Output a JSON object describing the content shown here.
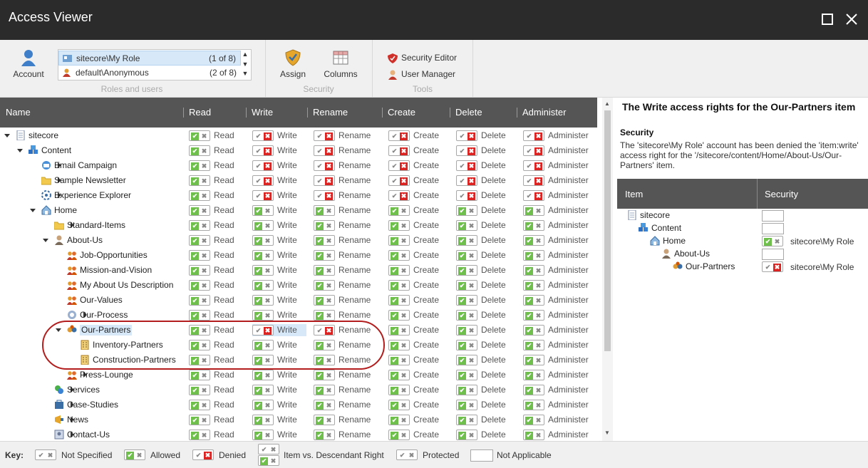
{
  "window": {
    "title": "Access Viewer",
    "maximize_icon": "maximize-icon",
    "close_icon": "close-icon"
  },
  "ribbon": {
    "account_label": "Account",
    "roles": [
      {
        "name": "sitecore\\My Role",
        "count": "(1 of 8)",
        "selected": true
      },
      {
        "name": "default\\Anonymous",
        "count": "(2 of 8)",
        "selected": false
      }
    ],
    "roles_group": "Roles and users",
    "assign_label": "Assign",
    "columns_label": "Columns",
    "security_group": "Security",
    "security_editor": "Security Editor",
    "user_manager": "User Manager",
    "tools_group": "Tools"
  },
  "grid": {
    "columns": [
      "Name",
      "Read",
      "Write",
      "Rename",
      "Create",
      "Delete",
      "Administer"
    ],
    "rows": [
      {
        "name": "sitecore",
        "level": 0,
        "toggle": "expanded",
        "icon": "page",
        "states": [
          "allowed",
          "denied",
          "denied",
          "denied",
          "denied",
          "denied"
        ]
      },
      {
        "name": "Content",
        "level": 1,
        "toggle": "expanded",
        "icon": "content",
        "states": [
          "allowed",
          "denied",
          "denied",
          "denied",
          "denied",
          "denied"
        ]
      },
      {
        "name": "Email Campaign",
        "level": 2,
        "toggle": "collapsed",
        "icon": "email",
        "states": [
          "allowed",
          "denied",
          "denied",
          "denied",
          "denied",
          "denied"
        ]
      },
      {
        "name": "Sample Newsletter",
        "level": 2,
        "toggle": "collapsed",
        "icon": "folder",
        "states": [
          "allowed",
          "denied",
          "denied",
          "denied",
          "denied",
          "denied"
        ]
      },
      {
        "name": "Experience Explorer",
        "level": 2,
        "toggle": "collapsed",
        "icon": "explorer",
        "states": [
          "allowed",
          "denied",
          "denied",
          "denied",
          "denied",
          "denied"
        ]
      },
      {
        "name": "Home",
        "level": 2,
        "toggle": "expanded",
        "icon": "home",
        "states": [
          "allowed",
          "allowed",
          "allowed",
          "allowed",
          "allowed",
          "allowed"
        ]
      },
      {
        "name": "Standard-Items",
        "level": 3,
        "toggle": "collapsed",
        "icon": "folder",
        "states": [
          "allowed",
          "allowed",
          "allowed",
          "allowed",
          "allowed",
          "allowed"
        ]
      },
      {
        "name": "About-Us",
        "level": 3,
        "toggle": "expanded",
        "icon": "person",
        "states": [
          "allowed",
          "allowed",
          "allowed",
          "allowed",
          "allowed",
          "allowed"
        ]
      },
      {
        "name": "Job-Opportunities",
        "level": 4,
        "toggle": "none",
        "icon": "group",
        "states": [
          "allowed",
          "allowed",
          "allowed",
          "allowed",
          "allowed",
          "allowed"
        ]
      },
      {
        "name": "Mission-and-Vision",
        "level": 4,
        "toggle": "none",
        "icon": "group",
        "states": [
          "allowed",
          "allowed",
          "allowed",
          "allowed",
          "allowed",
          "allowed"
        ]
      },
      {
        "name": "My About Us Description",
        "level": 4,
        "toggle": "none",
        "icon": "group",
        "states": [
          "allowed",
          "allowed",
          "allowed",
          "allowed",
          "allowed",
          "allowed"
        ]
      },
      {
        "name": "Our-Values",
        "level": 4,
        "toggle": "none",
        "icon": "group",
        "states": [
          "allowed",
          "allowed",
          "allowed",
          "allowed",
          "allowed",
          "allowed"
        ]
      },
      {
        "name": "Our-Process",
        "level": 4,
        "toggle": "collapsed",
        "icon": "process",
        "states": [
          "allowed",
          "allowed",
          "allowed",
          "allowed",
          "allowed",
          "allowed"
        ]
      },
      {
        "name": "Our-Partners",
        "level": 4,
        "toggle": "expanded",
        "icon": "partners",
        "selected": true,
        "states": [
          "allowed",
          "denied",
          "denied",
          "allowed",
          "allowed",
          "allowed"
        ]
      },
      {
        "name": "Inventory-Partners",
        "level": 5,
        "toggle": "none",
        "icon": "building",
        "states": [
          "allowed",
          "allowed",
          "allowed",
          "allowed",
          "allowed",
          "allowed"
        ]
      },
      {
        "name": "Construction-Partners",
        "level": 5,
        "toggle": "none",
        "icon": "building",
        "states": [
          "allowed",
          "allowed",
          "allowed",
          "allowed",
          "allowed",
          "allowed"
        ]
      },
      {
        "name": "Press-Lounge",
        "level": 4,
        "toggle": "collapsed",
        "icon": "group",
        "states": [
          "allowed",
          "allowed",
          "allowed",
          "allowed",
          "allowed",
          "allowed"
        ]
      },
      {
        "name": "Services",
        "level": 3,
        "toggle": "collapsed",
        "icon": "services",
        "states": [
          "allowed",
          "allowed",
          "allowed",
          "allowed",
          "allowed",
          "allowed"
        ]
      },
      {
        "name": "Case-Studies",
        "level": 3,
        "toggle": "collapsed",
        "icon": "case",
        "states": [
          "allowed",
          "allowed",
          "allowed",
          "allowed",
          "allowed",
          "allowed"
        ]
      },
      {
        "name": "News",
        "level": 3,
        "toggle": "collapsed",
        "icon": "news",
        "states": [
          "allowed",
          "allowed",
          "allowed",
          "allowed",
          "allowed",
          "allowed"
        ]
      },
      {
        "name": "Contact-Us",
        "level": 3,
        "toggle": "collapsed",
        "icon": "contact",
        "states": [
          "allowed",
          "allowed",
          "allowed",
          "allowed",
          "allowed",
          "allowed"
        ]
      }
    ],
    "highlight": {
      "row": 13,
      "col": 1
    }
  },
  "details": {
    "title": "The Write access rights for the Our-Partners item",
    "section": "Security",
    "description": "The 'sitecore\\My Role' account has been denied the 'item:write' access right for the '/sitecore/content/Home/About-Us/Our-Partners' item.",
    "col_item": "Item",
    "col_security": "Security",
    "rows": [
      {
        "name": "sitecore",
        "level": 0,
        "icon": "page",
        "state": "none",
        "account": ""
      },
      {
        "name": "Content",
        "level": 1,
        "icon": "content",
        "state": "none",
        "account": ""
      },
      {
        "name": "Home",
        "level": 2,
        "icon": "home",
        "state": "allowed",
        "account": "sitecore\\My Role"
      },
      {
        "name": "About-Us",
        "level": 3,
        "icon": "person",
        "state": "none",
        "account": ""
      },
      {
        "name": "Our-Partners",
        "level": 4,
        "icon": "partners",
        "state": "denied",
        "account": "sitecore\\My Role"
      }
    ]
  },
  "key": {
    "label": "Key:",
    "not_specified": "Not Specified",
    "allowed": "Allowed",
    "denied": "Denied",
    "item_vs_descendant": "Item vs. Descendant Right",
    "protected": "Protected",
    "not_applicable": "Not Applicable"
  },
  "colors": {
    "allowed": "#6fbf4c",
    "denied": "#dd2222",
    "header": "#555555",
    "titlebar": "#2b2b2b",
    "selection": "#d7e8f8",
    "callout": "#b31d1d"
  }
}
